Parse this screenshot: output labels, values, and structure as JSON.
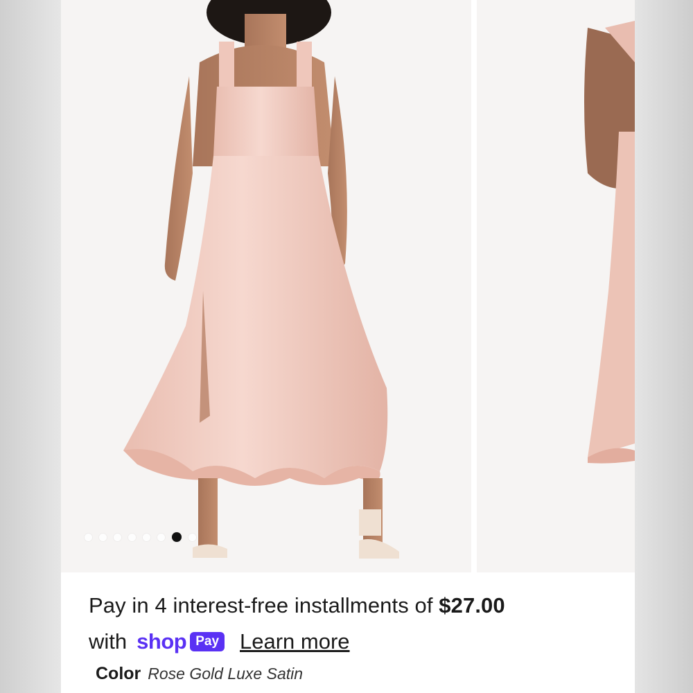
{
  "carousel": {
    "dots": [
      false,
      false,
      false,
      false,
      false,
      false,
      true,
      false
    ],
    "images": [
      "model-front-rose-dress-photo",
      "model-side-rose-dress-photo"
    ]
  },
  "payment": {
    "line1_prefix": "Pay in 4 interest-free installments of ",
    "amount": "$27.00",
    "with": "with",
    "shop_text": "shop",
    "pay_text": "Pay",
    "learn_more": "Learn more",
    "brand_color": "#5a31f4"
  },
  "variant": {
    "label": "Color",
    "value": "Rose Gold Luxe Satin"
  }
}
